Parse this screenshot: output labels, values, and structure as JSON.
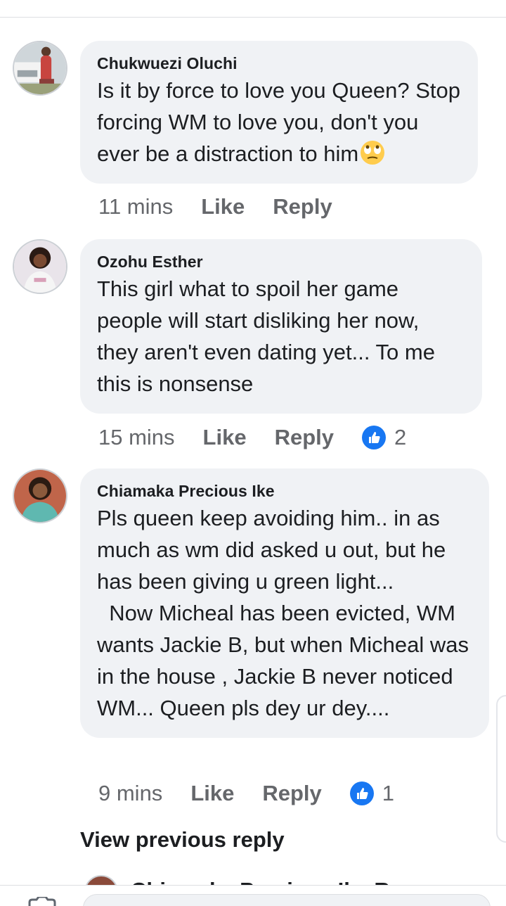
{
  "comments": [
    {
      "author": "Chukwuezi Oluchi",
      "text": "Is it by force to love you Queen? Stop forcing WM to love you, don't you ever be a distraction to him",
      "emoji": "eye-roll-emoji",
      "time": "11 mins",
      "like_label": "Like",
      "reply_label": "Reply",
      "reactions": null
    },
    {
      "author": "Ozohu Esther",
      "text": "This girl what to spoil her game people will start disliking her now, they aren't even dating yet... To me this is nonsense",
      "time": "15 mins",
      "like_label": "Like",
      "reply_label": "Reply",
      "reactions": "2"
    },
    {
      "author": "Chiamaka Precious Ike",
      "text": "Pls queen keep avoiding him.. in as much as wm did asked u out, but he has been giving u green light...\n  Now Micheal has been evicted, WM wants Jackie B, but when Micheal was in the house , Jackie B never noticed WM... Queen pls dey ur dey....",
      "time": "9 mins",
      "like_label": "Like",
      "reply_label": "Reply",
      "reactions": "1"
    }
  ],
  "view_previous_reply": "View previous reply",
  "next_comment_author_partial": "Chiamaka Precious Ike R",
  "colors": {
    "bubble": "#f0f2f5",
    "meta": "#65676b",
    "like_blue": "#1877f2"
  }
}
